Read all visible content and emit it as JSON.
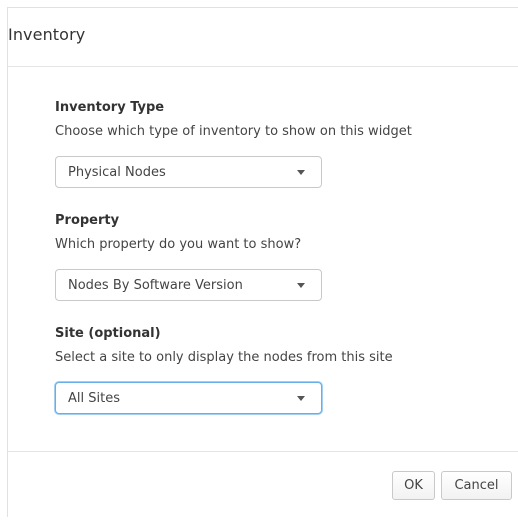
{
  "dialog": {
    "title": "Inventory"
  },
  "fields": {
    "inventory_type": {
      "label": "Inventory Type",
      "help": "Choose which type of inventory to show on this widget",
      "value": "Physical Nodes"
    },
    "property": {
      "label": "Property",
      "help": "Which property do you want to show?",
      "value": "Nodes By Software Version"
    },
    "site": {
      "label": "Site (optional)",
      "help": "Select a site to only display the nodes from this site",
      "value": "All Sites"
    }
  },
  "footer": {
    "ok_label": "OK",
    "cancel_label": "Cancel"
  },
  "colors": {
    "focus_border": "#66afe9",
    "text": "#333333",
    "divider": "#e5e5e5"
  }
}
